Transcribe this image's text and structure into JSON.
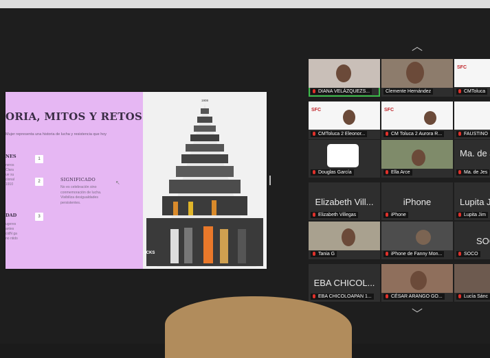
{
  "slide": {
    "title": "ORIA, MITOS Y RETOS",
    "intro": "Mujer representa una historia de lucha y resistencia que hoy",
    "sections": [
      {
        "heading": "NES",
        "number": "1",
        "body": "neros Clara ue su cional 1910"
      },
      {
        "heading": "",
        "number": "2",
        "body": ""
      },
      {
        "heading": "DAD",
        "number": "3",
        "body": "ugeres antes cidN ga no ntido"
      }
    ],
    "significado_title": "SIGNIFICADO",
    "significado_text": "No es celebración sino conmemoración de lucha. Visibiliza desigualdades persistentes.",
    "pyramid_year": "1908",
    "pyramid_caption": "ICKS",
    "left_color": "#e6b7f3"
  },
  "gallery": {
    "nav_up": "︿",
    "nav_down": "﹀",
    "participants": [
      {
        "label": "DIANA VELÁZQUEZS...",
        "type": "video",
        "active": true
      },
      {
        "label": "Clemente Hernández",
        "type": "video"
      },
      {
        "label": "CMToluca",
        "type": "sfc"
      },
      {
        "label": "CMToluca 2 Eleonor...",
        "type": "sfc"
      },
      {
        "label": "CM Toluca 2 Aurora R...",
        "type": "sfc"
      },
      {
        "label": "FAUSTINO",
        "type": "sfc"
      },
      {
        "label": "Douglas García",
        "type": "avatar"
      },
      {
        "label": "Ella Arce",
        "type": "video"
      },
      {
        "label": "Ma. de Jes",
        "type": "text",
        "big": "Ma. de J"
      },
      {
        "label": "Elizabeth Villegas",
        "type": "text",
        "big": "Elizabeth Vill..."
      },
      {
        "label": "iPhone",
        "type": "text",
        "big": "iPhone"
      },
      {
        "label": "Lupita Jim",
        "type": "text",
        "big": "Lupita J"
      },
      {
        "label": "Tania G",
        "type": "video"
      },
      {
        "label": "iPhone de Fanny Mon...",
        "type": "video"
      },
      {
        "label": "SOCO",
        "type": "text",
        "big": "SOC"
      },
      {
        "label": "EBA CHICOLOAPAN 1...",
        "type": "text",
        "big": "EBA CHICOL..."
      },
      {
        "label": "CÉSAR ARANGO GO...",
        "type": "video"
      },
      {
        "label": "Lucía Sánc",
        "type": "video"
      }
    ],
    "active_color": "#3dbb4b",
    "mic_color": "#e0312b"
  }
}
